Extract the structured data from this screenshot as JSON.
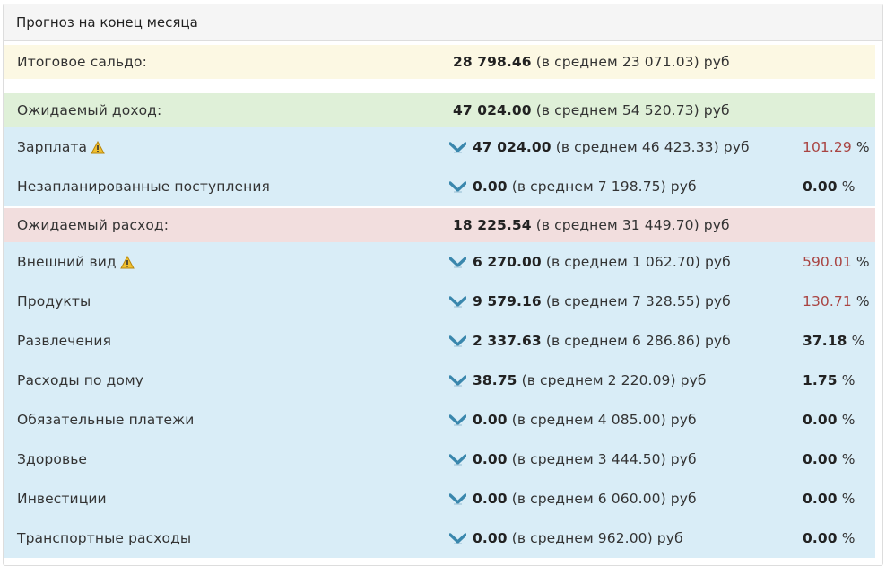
{
  "panel": {
    "title": "Прогноз на конец месяца"
  },
  "balance": {
    "label": "Итоговое сальдо:",
    "amount": "28 798.46",
    "rest": "(в среднем 23 071.03) руб"
  },
  "income": {
    "label": "Ожидаемый доход:",
    "amount": "47 024.00",
    "rest": "(в среднем 54 520.73) руб",
    "items": [
      {
        "label": "Зарплата",
        "warn": true,
        "amount": "47 024.00",
        "rest": "(в среднем 46 423.33) руб",
        "pct": "101.29",
        "pct_unit": "%",
        "red": true
      },
      {
        "label": "Незапланированные поступления",
        "warn": false,
        "amount": "0.00",
        "rest": "(в среднем 7 198.75) руб",
        "pct": "0.00",
        "pct_unit": "%",
        "red": false
      }
    ]
  },
  "expense": {
    "label": "Ожидаемый расход:",
    "amount": "18 225.54",
    "rest": "(в среднем 31 449.70) руб",
    "items": [
      {
        "label": "Внешний вид",
        "warn": true,
        "amount": "6 270.00",
        "rest": "(в среднем 1 062.70) руб",
        "pct": "590.01",
        "pct_unit": "%",
        "red": true
      },
      {
        "label": "Продукты",
        "warn": false,
        "amount": "9 579.16",
        "rest": "(в среднем 7 328.55) руб",
        "pct": "130.71",
        "pct_unit": "%",
        "red": true
      },
      {
        "label": "Развлечения",
        "warn": false,
        "amount": "2 337.63",
        "rest": "(в среднем 6 286.86) руб",
        "pct": "37.18",
        "pct_unit": "%",
        "red": false
      },
      {
        "label": "Расходы по дому",
        "warn": false,
        "amount": "38.75",
        "rest": "(в среднем 2 220.09) руб",
        "pct": "1.75",
        "pct_unit": "%",
        "red": false
      },
      {
        "label": "Обязательные платежи",
        "warn": false,
        "amount": "0.00",
        "rest": "(в среднем 4 085.00) руб",
        "pct": "0.00",
        "pct_unit": "%",
        "red": false
      },
      {
        "label": "Здоровье",
        "warn": false,
        "amount": "0.00",
        "rest": "(в среднем 3 444.50) руб",
        "pct": "0.00",
        "pct_unit": "%",
        "red": false
      },
      {
        "label": "Инвестиции",
        "warn": false,
        "amount": "0.00",
        "rest": "(в среднем 6 060.00) руб",
        "pct": "0.00",
        "pct_unit": "%",
        "red": false
      },
      {
        "label": "Транспортные расходы",
        "warn": false,
        "amount": "0.00",
        "rest": "(в среднем 962.00) руб",
        "pct": "0.00",
        "pct_unit": "%",
        "red": false
      }
    ]
  },
  "colors": {
    "balance_bg": "#fcf8e3",
    "income_bg": "#dff0d8",
    "expense_bg": "#f2dede",
    "item_bg": "#d9edf7",
    "overrun": "#a94442",
    "arrow": "#3a87ad",
    "warning": "#f0c030"
  },
  "icons": {
    "expand": "chevron-down-icon",
    "warning": "warning-icon"
  }
}
